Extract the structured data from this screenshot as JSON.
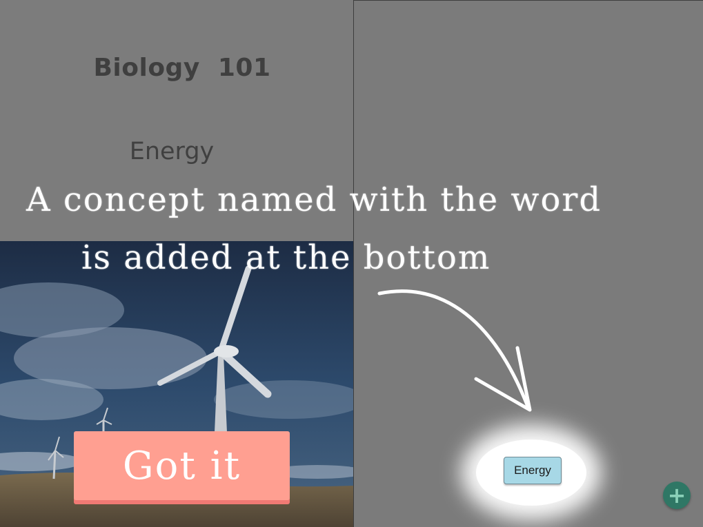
{
  "document": {
    "course_title": "Biology  101",
    "topic_word": "Energy"
  },
  "tutorial": {
    "line1": "A concept named with the word",
    "line2": "is added at the bottom",
    "got_it_label": "Got it"
  },
  "concept_map": {
    "new_concept_label": "Energy",
    "add_icon": "plus-icon"
  },
  "colors": {
    "got_it_button": "#ff9f91",
    "concept_node": "#a7d8e6",
    "add_button": "#2f7765"
  }
}
